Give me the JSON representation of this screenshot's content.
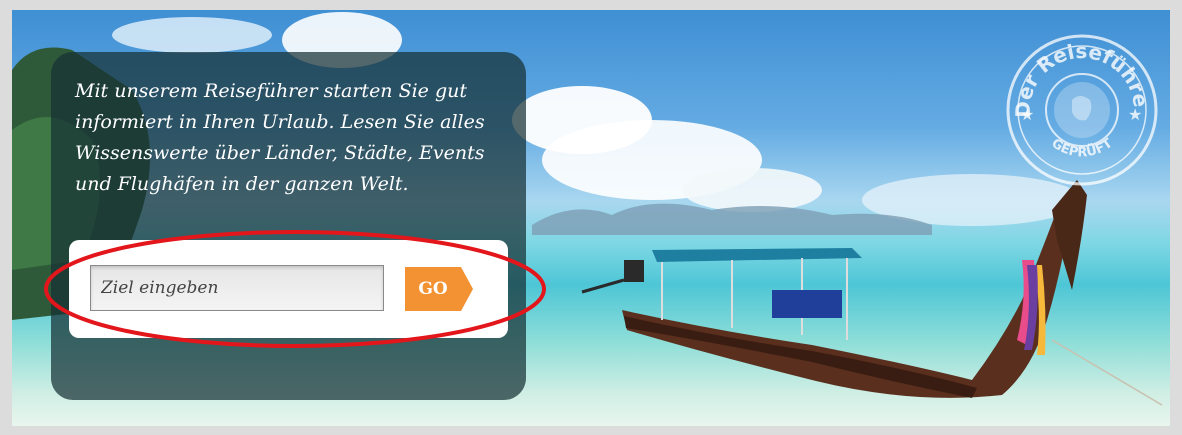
{
  "hero": {
    "intro_text": "Mit unserem Reiseführer starten Sie gut informiert in Ihren Urlaub. Lesen Sie alles Wissenswerte über Länder, Städte, Events und Flughäfen in der ganzen Welt."
  },
  "search": {
    "placeholder": "Ziel eingeben",
    "value": "",
    "button_label": "GO"
  },
  "stamp": {
    "top_text": "Der Reiseführer",
    "bottom_text": "GEPRÜFT"
  },
  "colors": {
    "go_button": "#f39233",
    "panel_overlay": "#163034",
    "highlight_ring": "#e3161b"
  }
}
